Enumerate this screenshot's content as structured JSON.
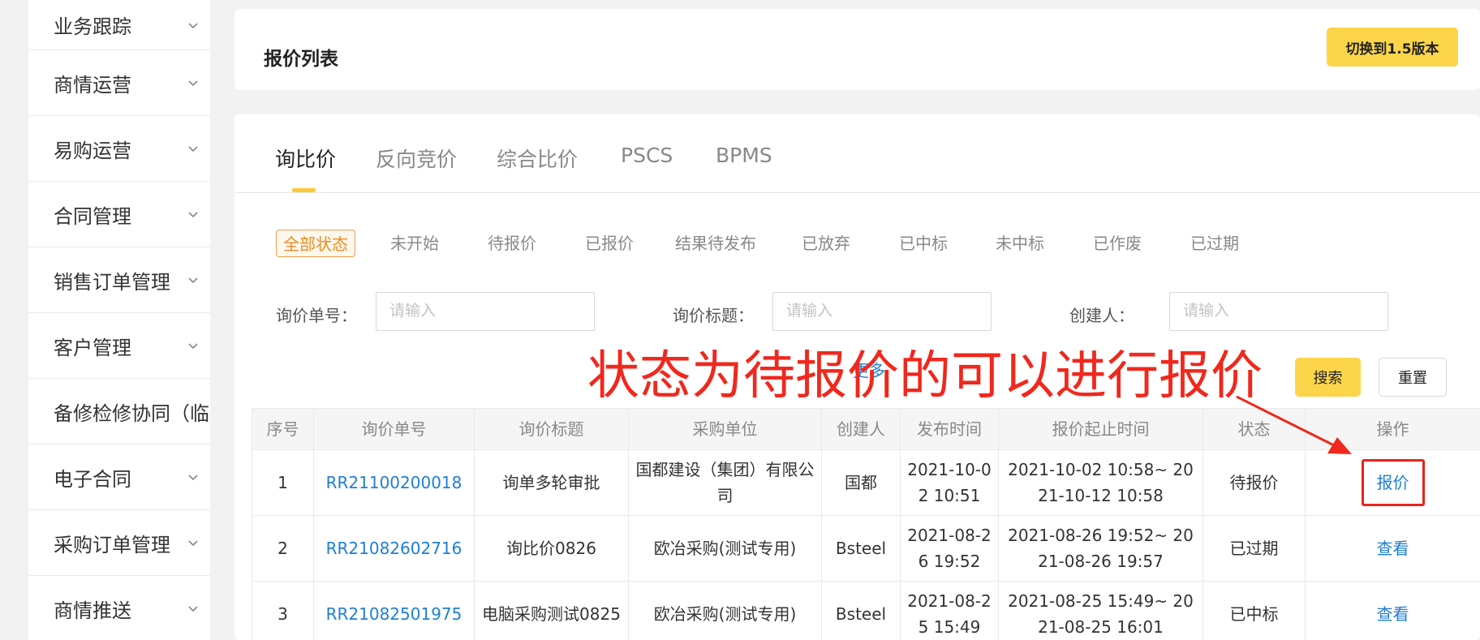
{
  "sidebar": {
    "items": [
      {
        "label": "业务跟踪"
      },
      {
        "label": "商情运营"
      },
      {
        "label": "易购运营"
      },
      {
        "label": "合同管理"
      },
      {
        "label": "销售订单管理"
      },
      {
        "label": "客户管理"
      },
      {
        "label": "备修检修协同（临"
      },
      {
        "label": "电子合同"
      },
      {
        "label": "采购订单管理"
      },
      {
        "label": "商情推送"
      }
    ]
  },
  "header": {
    "title": "报价列表",
    "switch_button": "切换到1.5版本"
  },
  "tabs": [
    "询比价",
    "反向竞价",
    "综合比价",
    "PSCS",
    "BPMS"
  ],
  "status_filters": [
    "全部状态",
    "未开始",
    "待报价",
    "已报价",
    "结果待发布",
    "已放弃",
    "已中标",
    "未中标",
    "已作废",
    "已过期"
  ],
  "filters": {
    "inquiry_no": {
      "label": "询价单号：",
      "placeholder": "请输入"
    },
    "inquiry_title": {
      "label": "询价标题：",
      "placeholder": "请输入"
    },
    "creator": {
      "label": "创建人：",
      "placeholder": "请输入"
    },
    "more": "更多",
    "search": "搜索",
    "reset": "重置"
  },
  "table": {
    "headers": [
      "序号",
      "询价单号",
      "询价标题",
      "采购单位",
      "创建人",
      "发布时间",
      "报价起止时间",
      "状态",
      "操作"
    ],
    "rows": [
      {
        "index": "1",
        "no": "RR21100200018",
        "title": "询单多轮审批",
        "unit": "国都建设（集团）有限公司",
        "creator": "国都",
        "published": "2021-10-02 10:51",
        "period": "2021-10-02 10:58~ 2021-10-12 10:58",
        "status": "待报价",
        "action": "报价"
      },
      {
        "index": "2",
        "no": "RR21082602716",
        "title": "询比价0826",
        "unit": "欧冶采购(测试专用)",
        "creator": "Bsteel",
        "published": "2021-08-26 19:52",
        "period": "2021-08-26 19:52~ 2021-08-26 19:57",
        "status": "已过期",
        "action": "查看"
      },
      {
        "index": "3",
        "no": "RR21082501975",
        "title": "电脑采购测试0825",
        "unit": "欧冶采购(测试专用)",
        "creator": "Bsteel",
        "published": "2021-08-25 15:49",
        "period": "2021-08-25 15:49~ 2021-08-25 16:01",
        "status": "已中标",
        "action": "查看"
      }
    ]
  },
  "annotation": {
    "text": "状态为待报价的可以进行报价",
    "color": "#f0281d"
  },
  "colors": {
    "accent_yellow": "#fcd54a",
    "link_blue": "#1f7ed6",
    "active_orange": "#f08a1c"
  }
}
